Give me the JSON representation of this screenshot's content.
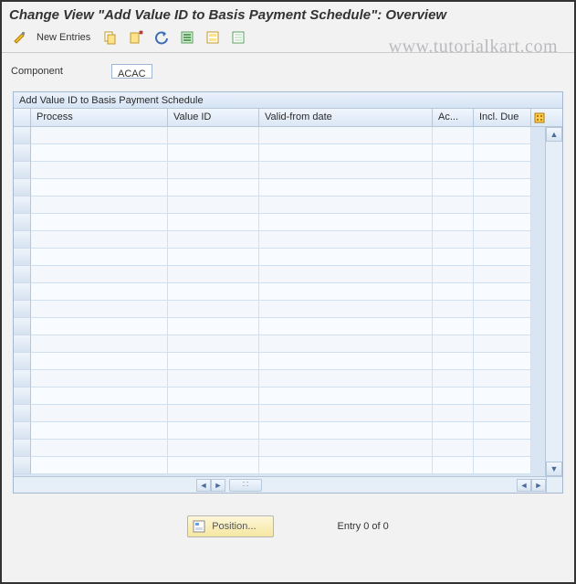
{
  "title": "Change View \"Add Value ID to Basis Payment Schedule\": Overview",
  "watermark": "www.tutorialkart.com",
  "toolbar": {
    "new_entries": "New Entries"
  },
  "component": {
    "label": "Component",
    "value": "ACAC"
  },
  "table": {
    "caption": "Add Value ID to Basis Payment Schedule",
    "columns": [
      "Process",
      "Value ID",
      "Valid-from date",
      "Ac...",
      "Incl. Due"
    ],
    "row_count": 20
  },
  "footer": {
    "position_label": "Position...",
    "entry_text": "Entry 0 of 0"
  },
  "icons": {
    "toggle": "toggle-display-change-icon",
    "copy": "copy-as-icon",
    "delete": "delete-icon",
    "undo": "undo-icon",
    "select_all": "select-all-icon",
    "select_block": "select-block-icon",
    "deselect_all": "deselect-all-icon",
    "configure": "table-settings-icon"
  }
}
